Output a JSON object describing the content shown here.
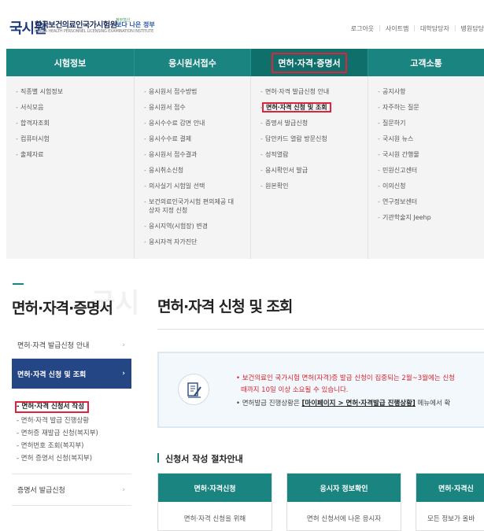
{
  "header": {
    "logo_mark": "국시원",
    "logo_text": "한국보건의료인국가시험원",
    "logo_subtext": "KOREA HEALTH PERSONNEL LICENSING EXAMINATION INSTITUTE",
    "slogan_small": "정부혁신",
    "slogan": "보다 나은 정부",
    "util_links": [
      "로그아웃",
      "사이트맵",
      "대학담당자",
      "병원담당"
    ]
  },
  "nav": {
    "items": [
      "시험정보",
      "응시원서접수",
      "면허·자격·증명서",
      "고객소통"
    ],
    "active_index": 2
  },
  "mega_menu": {
    "columns": [
      [
        "직종별 시험정보",
        "서식모음",
        "합격자조회",
        "컴퓨터시험",
        "출제자료"
      ],
      [
        "응시원서 접수방법",
        "응시원서 접수",
        "응시수수료 감면 안내",
        "응시수수료 결제",
        "응시원서 접수결과",
        "응시취소신청",
        "의사실기 시험일 선택",
        "보건의료인국가시험 편의제공 대상자 지정 신청",
        "응시지역(시험장) 변경",
        "응시자격 자가진단"
      ],
      [
        "면허·자격 발급신청 안내",
        "면허·자격 신청 및 조회",
        "증명서 발급신청",
        "답안카드 열람 방문신청",
        "성적열람",
        "응시확인서 발급",
        "원본확인"
      ],
      [
        "공지사항",
        "자주하는 질문",
        "질문하기",
        "국시원 뉴스",
        "국시원 간행물",
        "민원신고센터",
        "이의신청",
        "연구정보센터",
        "기관학술지 Jeehp"
      ]
    ],
    "highlight": {
      "column": 2,
      "item": 1
    }
  },
  "sidebar": {
    "title": "면허·자격·증명서",
    "watermark": "국시",
    "items": [
      {
        "label": "면허·자격 발급신청 안내",
        "active": false
      },
      {
        "label": "면허·자격 신청 및 조회",
        "active": true
      },
      {
        "label": "증명서 발급신청",
        "active": false
      }
    ],
    "sub_items": [
      "면허·자격 신청서 작성",
      "면허·자격 발급 진행상황",
      "면허증 재발급 신청(복지부)",
      "면허번호 조회(복지부)",
      "면허 증명서 신청(복지부)"
    ],
    "current_sub": 0
  },
  "main": {
    "page_title": "면허·자격 신청 및 조회",
    "notice": {
      "line1": "• 보건의료인 국가시험 면허(자격)증 발급 신청이 집중되는 2월~3월에는 신청",
      "line2": "때까지 10일 이상 소요될 수 있습니다.",
      "line3_prefix": "• 면허발급 진행상황은 ",
      "line3_link": "[마이페이지 > 면허·자격발급 진행상황]",
      "line3_suffix": " 메뉴에서 확"
    },
    "guide_title": "신청서 작성 절차안내",
    "steps": [
      {
        "title": "면허·자격신청",
        "body": "면허·자격 신청을 위해"
      },
      {
        "title": "응시자 정보확인",
        "body": "면허 신청서에 나온 응시자"
      },
      {
        "title": "면허·자격신",
        "body": "모든 정보가 올바"
      }
    ]
  },
  "colors": {
    "teal": "#1a8580",
    "navy": "#244684",
    "highlight_red": "#e0233a"
  }
}
